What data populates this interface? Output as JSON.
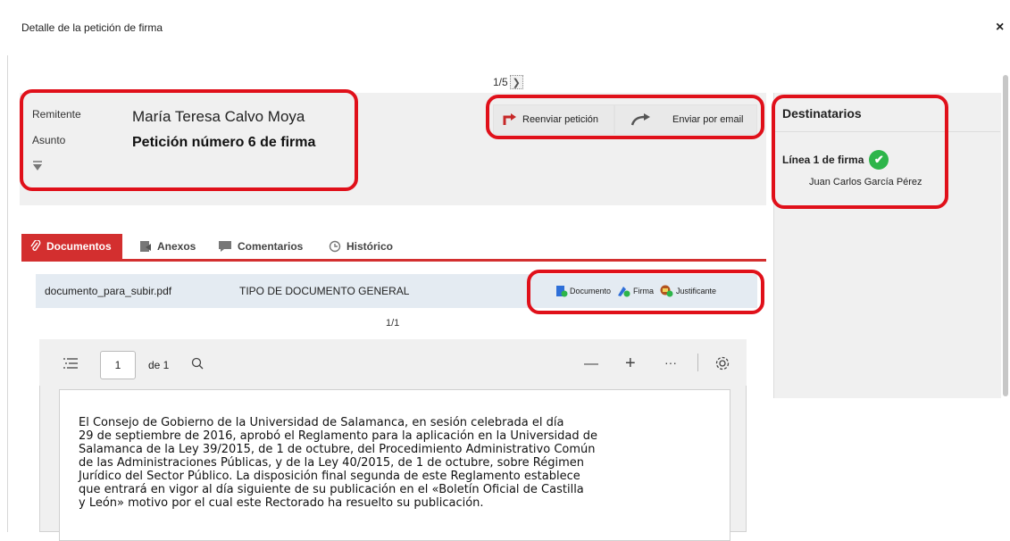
{
  "dialog": {
    "title": "Detalle de la petición de firma",
    "close_label": "×"
  },
  "pager": {
    "text": "1/5",
    "next_icon": "chevron-right-icon",
    "next_glyph": "❯"
  },
  "header": {
    "sender_label": "Remitente",
    "sender_value": "María Teresa Calvo Moya",
    "subject_label": "Asunto",
    "subject_value": "Petición número 6 de firma",
    "filter_glyph": "▼"
  },
  "actions": {
    "resend_label": "Reenviar petición",
    "email_label": "Enviar por email"
  },
  "recipients": {
    "title": "Destinatarios",
    "line_label": "Línea 1 de firma",
    "check_glyph": "✔",
    "person": "Juan Carlos García Pérez"
  },
  "tabs": {
    "documentos": "Documentos",
    "anexos": "Anexos",
    "comentarios": "Comentarios",
    "historico": "Histórico"
  },
  "document": {
    "filename": "documento_para_subir.pdf",
    "type": "TIPO DE DOCUMENTO GENERAL",
    "doc_btn": "Documento",
    "sign_btn": "Firma",
    "justif_btn": "Justificante",
    "page_count": "1/1"
  },
  "viewer": {
    "page_value": "1",
    "page_total": "de 1",
    "zoom_out": "—",
    "zoom_in": "+",
    "more": "···",
    "text_lines": [
      "El Consejo de Gobierno de la Universidad de Salamanca, en sesión celebrada el día",
      "29 de septiembre de 2016, aprobó el Reglamento para la aplicación en la Universidad de",
      "Salamanca de la Ley 39/2015, de 1 de octubre, del Procedimiento Administrativo Común",
      "de las Administraciones Públicas, y de la Ley 40/2015, de 1 de octubre, sobre Régimen",
      "Jurídico del Sector Público. La disposición final segunda de este Reglamento establece",
      "que entrará en vigor al día siguiente de su publicación en el «Boletín Oficial de Castilla",
      "y León» motivo por el cual este Rectorado ha resuelto su publicación."
    ]
  },
  "colors": {
    "accent": "#d32f2f",
    "highlight": "#e0101a",
    "success": "#2db54a"
  }
}
